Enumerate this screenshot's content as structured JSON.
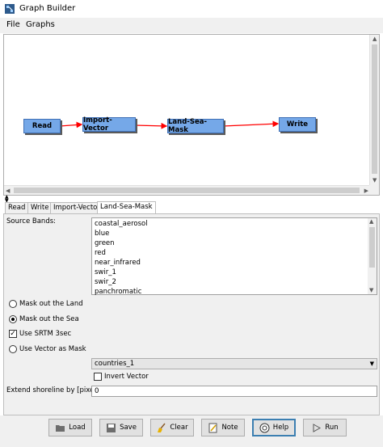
{
  "window": {
    "title": "Graph Builder"
  },
  "menu": {
    "items": [
      "File",
      "Graphs"
    ]
  },
  "graph": {
    "nodes": [
      {
        "label": "Read"
      },
      {
        "label": "Import-Vector"
      },
      {
        "label": "Land-Sea-Mask"
      },
      {
        "label": "Write"
      }
    ],
    "edge_color": "#ff0000",
    "node_color": "#75a8e8"
  },
  "tabs": [
    "Read",
    "Write",
    "Import-Vector",
    "Land-Sea-Mask"
  ],
  "active_tab": "Land-Sea-Mask",
  "panel": {
    "source_bands_label": "Source Bands:",
    "bands": [
      "coastal_aerosol",
      "blue",
      "green",
      "red",
      "near_infrared",
      "swir_1",
      "swir_2",
      "panchromatic"
    ],
    "mask_land_label": "Mask out the Land",
    "mask_sea_label": "Mask out the Sea",
    "use_srtm_label": "Use SRTM 3sec",
    "use_vector_label": "Use Vector as Mask",
    "vector_value": "countries_1",
    "invert_vector_label": "Invert Vector",
    "extend_shoreline_label": "Extend shoreline by [pixels]:",
    "extend_shoreline_value": "0",
    "selected_radio": "Mask out the Sea",
    "use_srtm_checked": true,
    "invert_vector_checked": false
  },
  "buttons": {
    "load": "Load",
    "save": "Save",
    "clear": "Clear",
    "note": "Note",
    "help": "Help",
    "run": "Run"
  }
}
